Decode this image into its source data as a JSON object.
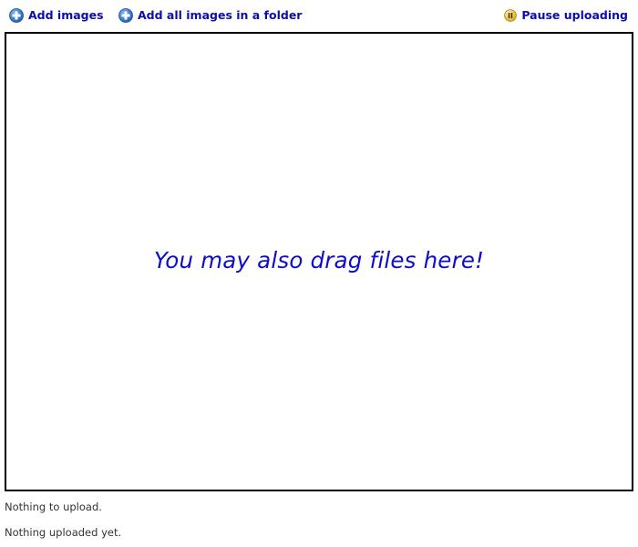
{
  "toolbar": {
    "add_images_label": "Add images",
    "add_folder_label": "Add all images in a folder",
    "pause_label": "Pause uploading",
    "icons": {
      "add_images": "plus-circle-icon",
      "add_folder": "plus-circle-icon",
      "pause": "pause-circle-icon"
    }
  },
  "dropzone": {
    "message": "You may also drag files here!"
  },
  "status": {
    "queue": "Nothing to upload.",
    "uploaded": "Nothing uploaded yet."
  },
  "colors": {
    "link": "#0d0dae",
    "dropzone_text": "#0d0dcc",
    "plus_icon": "#2b6ec4",
    "pause_icon": "#e8b830",
    "border": "#000000",
    "status_text": "#333333"
  }
}
